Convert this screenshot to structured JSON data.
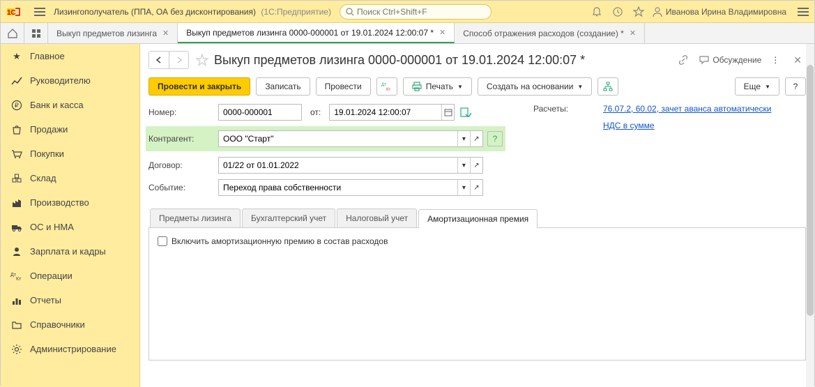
{
  "titlebar": {
    "app_title": "Лизингополучатель (ППА, ОА без дисконтирования)",
    "app_sub": "(1С:Предприятие)",
    "search_placeholder": "Поиск Ctrl+Shift+F",
    "user_name": "Иванова Ирина Владимировна"
  },
  "tabs": [
    {
      "label": "Выкуп предметов лизинга",
      "closeable": true,
      "active": false
    },
    {
      "label": "Выкуп предметов лизинга 0000-000001 от 19.01.2024 12:00:07 *",
      "closeable": true,
      "active": true
    },
    {
      "label": "Способ отражения расходов (создание) *",
      "closeable": true,
      "active": false
    }
  ],
  "sidebar": [
    {
      "icon": "star",
      "label": "Главное"
    },
    {
      "icon": "chart-line",
      "label": "Руководителю"
    },
    {
      "icon": "ruble",
      "label": "Банк и касса"
    },
    {
      "icon": "bag",
      "label": "Продажи"
    },
    {
      "icon": "cart",
      "label": "Покупки"
    },
    {
      "icon": "boxes",
      "label": "Склад"
    },
    {
      "icon": "factory",
      "label": "Производство"
    },
    {
      "icon": "truck",
      "label": "ОС и НМА"
    },
    {
      "icon": "person",
      "label": "Зарплата и кадры"
    },
    {
      "icon": "dtkt",
      "label": "Операции"
    },
    {
      "icon": "bars",
      "label": "Отчеты"
    },
    {
      "icon": "folder",
      "label": "Справочники"
    },
    {
      "icon": "gear",
      "label": "Администрирование"
    }
  ],
  "page": {
    "title": "Выкуп предметов лизинга 0000-000001 от 19.01.2024 12:00:07 *",
    "discuss_label": "Обсуждение"
  },
  "toolbar": {
    "post_close": "Провести и закрыть",
    "save": "Записать",
    "post": "Провести",
    "print": "Печать",
    "create_based": "Создать на основании",
    "more": "Еще",
    "help": "?"
  },
  "form": {
    "number_label": "Номер:",
    "number_value": "0000-000001",
    "from_label": "от:",
    "date_value": "19.01.2024 12:00:07",
    "counterparty_label": "Контрагент:",
    "counterparty_value": "ООО \"Старт\"",
    "contract_label": "Договор:",
    "contract_value": "01/22 от 01.01.2022",
    "event_label": "Событие:",
    "event_value": "Переход права собственности",
    "calc_label": "Расчеты:",
    "calc_link": "76.07.2, 60.02, зачет аванса автоматически",
    "vat_link": "НДС в сумме"
  },
  "subtabs": [
    {
      "label": "Предметы лизинга",
      "active": false
    },
    {
      "label": "Бухгалтерский учет",
      "active": false
    },
    {
      "label": "Налоговый учет",
      "active": false
    },
    {
      "label": "Амортизационная премия",
      "active": true
    }
  ],
  "tabpanel": {
    "checkbox_label": "Включить амортизационную премию в состав расходов"
  }
}
